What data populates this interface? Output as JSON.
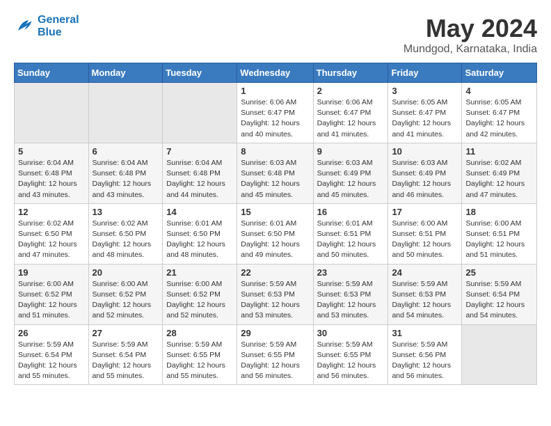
{
  "header": {
    "logo_line1": "General",
    "logo_line2": "Blue",
    "title": "May 2024",
    "location": "Mundgod, Karnataka, India"
  },
  "days_of_week": [
    "Sunday",
    "Monday",
    "Tuesday",
    "Wednesday",
    "Thursday",
    "Friday",
    "Saturday"
  ],
  "weeks": [
    [
      {
        "num": "",
        "info": ""
      },
      {
        "num": "",
        "info": ""
      },
      {
        "num": "",
        "info": ""
      },
      {
        "num": "1",
        "info": "Sunrise: 6:06 AM\nSunset: 6:47 PM\nDaylight: 12 hours\nand 40 minutes."
      },
      {
        "num": "2",
        "info": "Sunrise: 6:06 AM\nSunset: 6:47 PM\nDaylight: 12 hours\nand 41 minutes."
      },
      {
        "num": "3",
        "info": "Sunrise: 6:05 AM\nSunset: 6:47 PM\nDaylight: 12 hours\nand 41 minutes."
      },
      {
        "num": "4",
        "info": "Sunrise: 6:05 AM\nSunset: 6:47 PM\nDaylight: 12 hours\nand 42 minutes."
      }
    ],
    [
      {
        "num": "5",
        "info": "Sunrise: 6:04 AM\nSunset: 6:48 PM\nDaylight: 12 hours\nand 43 minutes."
      },
      {
        "num": "6",
        "info": "Sunrise: 6:04 AM\nSunset: 6:48 PM\nDaylight: 12 hours\nand 43 minutes."
      },
      {
        "num": "7",
        "info": "Sunrise: 6:04 AM\nSunset: 6:48 PM\nDaylight: 12 hours\nand 44 minutes."
      },
      {
        "num": "8",
        "info": "Sunrise: 6:03 AM\nSunset: 6:48 PM\nDaylight: 12 hours\nand 45 minutes."
      },
      {
        "num": "9",
        "info": "Sunrise: 6:03 AM\nSunset: 6:49 PM\nDaylight: 12 hours\nand 45 minutes."
      },
      {
        "num": "10",
        "info": "Sunrise: 6:03 AM\nSunset: 6:49 PM\nDaylight: 12 hours\nand 46 minutes."
      },
      {
        "num": "11",
        "info": "Sunrise: 6:02 AM\nSunset: 6:49 PM\nDaylight: 12 hours\nand 47 minutes."
      }
    ],
    [
      {
        "num": "12",
        "info": "Sunrise: 6:02 AM\nSunset: 6:50 PM\nDaylight: 12 hours\nand 47 minutes."
      },
      {
        "num": "13",
        "info": "Sunrise: 6:02 AM\nSunset: 6:50 PM\nDaylight: 12 hours\nand 48 minutes."
      },
      {
        "num": "14",
        "info": "Sunrise: 6:01 AM\nSunset: 6:50 PM\nDaylight: 12 hours\nand 48 minutes."
      },
      {
        "num": "15",
        "info": "Sunrise: 6:01 AM\nSunset: 6:50 PM\nDaylight: 12 hours\nand 49 minutes."
      },
      {
        "num": "16",
        "info": "Sunrise: 6:01 AM\nSunset: 6:51 PM\nDaylight: 12 hours\nand 50 minutes."
      },
      {
        "num": "17",
        "info": "Sunrise: 6:00 AM\nSunset: 6:51 PM\nDaylight: 12 hours\nand 50 minutes."
      },
      {
        "num": "18",
        "info": "Sunrise: 6:00 AM\nSunset: 6:51 PM\nDaylight: 12 hours\nand 51 minutes."
      }
    ],
    [
      {
        "num": "19",
        "info": "Sunrise: 6:00 AM\nSunset: 6:52 PM\nDaylight: 12 hours\nand 51 minutes."
      },
      {
        "num": "20",
        "info": "Sunrise: 6:00 AM\nSunset: 6:52 PM\nDaylight: 12 hours\nand 52 minutes."
      },
      {
        "num": "21",
        "info": "Sunrise: 6:00 AM\nSunset: 6:52 PM\nDaylight: 12 hours\nand 52 minutes."
      },
      {
        "num": "22",
        "info": "Sunrise: 5:59 AM\nSunset: 6:53 PM\nDaylight: 12 hours\nand 53 minutes."
      },
      {
        "num": "23",
        "info": "Sunrise: 5:59 AM\nSunset: 6:53 PM\nDaylight: 12 hours\nand 53 minutes."
      },
      {
        "num": "24",
        "info": "Sunrise: 5:59 AM\nSunset: 6:53 PM\nDaylight: 12 hours\nand 54 minutes."
      },
      {
        "num": "25",
        "info": "Sunrise: 5:59 AM\nSunset: 6:54 PM\nDaylight: 12 hours\nand 54 minutes."
      }
    ],
    [
      {
        "num": "26",
        "info": "Sunrise: 5:59 AM\nSunset: 6:54 PM\nDaylight: 12 hours\nand 55 minutes."
      },
      {
        "num": "27",
        "info": "Sunrise: 5:59 AM\nSunset: 6:54 PM\nDaylight: 12 hours\nand 55 minutes."
      },
      {
        "num": "28",
        "info": "Sunrise: 5:59 AM\nSunset: 6:55 PM\nDaylight: 12 hours\nand 55 minutes."
      },
      {
        "num": "29",
        "info": "Sunrise: 5:59 AM\nSunset: 6:55 PM\nDaylight: 12 hours\nand 56 minutes."
      },
      {
        "num": "30",
        "info": "Sunrise: 5:59 AM\nSunset: 6:55 PM\nDaylight: 12 hours\nand 56 minutes."
      },
      {
        "num": "31",
        "info": "Sunrise: 5:59 AM\nSunset: 6:56 PM\nDaylight: 12 hours\nand 56 minutes."
      },
      {
        "num": "",
        "info": ""
      }
    ]
  ]
}
